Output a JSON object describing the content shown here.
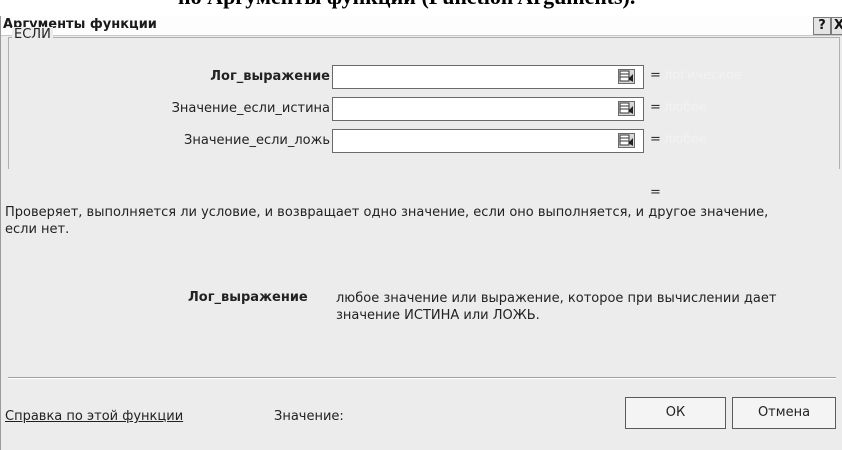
{
  "caption": "но Аргументы функции (Function Arguments).",
  "window": {
    "title": "Аргументы функции",
    "help_button": "?",
    "close_button": "X"
  },
  "function_name": "ЕСЛИ",
  "arguments": [
    {
      "label": "Лог_выражение",
      "value": "",
      "hint": "логическое"
    },
    {
      "label": "Значение_если_истина",
      "value": "",
      "hint": "любое"
    },
    {
      "label": "Значение_если_ложь",
      "value": "",
      "hint": "любое"
    }
  ],
  "equals_sign": "=",
  "result_equals": "=",
  "description": "Проверяет, выполняется ли условие, и возвращает одно значение, если оно выполняется, и другое значение, если нет.",
  "argument_help": {
    "name": "Лог_выражение",
    "text": "любое значение или выражение, которое при вычислении дает значение ИСТИНА или ЛОЖЬ."
  },
  "footer": {
    "help_link": "Справка по этой функции",
    "value_label": "Значение:",
    "ok_label": "ОК",
    "cancel_label": "Отмена"
  }
}
